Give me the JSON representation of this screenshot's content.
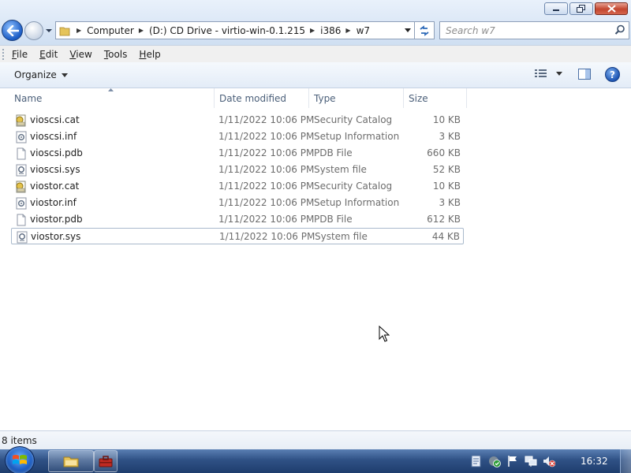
{
  "window": {
    "minimize_icon": "minimize-icon",
    "maximize_icon": "restore-icon",
    "close_icon": "close-icon"
  },
  "address": {
    "crumbs": [
      "Computer",
      "(D:) CD Drive - virtio-win-0.1.215",
      "i386",
      "w7"
    ]
  },
  "search": {
    "placeholder": "Search w7"
  },
  "menu": {
    "file": "File",
    "edit": "Edit",
    "view": "View",
    "tools": "Tools",
    "help": "Help"
  },
  "toolbar": {
    "organize_label": "Organize",
    "help_label": "?"
  },
  "columns": {
    "name": "Name",
    "date": "Date modified",
    "type": "Type",
    "size": "Size"
  },
  "files": [
    {
      "name": "vioscsi.cat",
      "date": "1/11/2022 10:06 PM",
      "type": "Security Catalog",
      "size": "10 KB",
      "icon": "catalog-icon"
    },
    {
      "name": "vioscsi.inf",
      "date": "1/11/2022 10:06 PM",
      "type": "Setup Information",
      "size": "3 KB",
      "icon": "setup-info-icon"
    },
    {
      "name": "vioscsi.pdb",
      "date": "1/11/2022 10:06 PM",
      "type": "PDB File",
      "size": "660 KB",
      "icon": "blank-file-icon"
    },
    {
      "name": "vioscsi.sys",
      "date": "1/11/2022 10:06 PM",
      "type": "System file",
      "size": "52 KB",
      "icon": "system-file-icon"
    },
    {
      "name": "viostor.cat",
      "date": "1/11/2022 10:06 PM",
      "type": "Security Catalog",
      "size": "10 KB",
      "icon": "catalog-icon"
    },
    {
      "name": "viostor.inf",
      "date": "1/11/2022 10:06 PM",
      "type": "Setup Information",
      "size": "3 KB",
      "icon": "setup-info-icon"
    },
    {
      "name": "viostor.pdb",
      "date": "1/11/2022 10:06 PM",
      "type": "PDB File",
      "size": "612 KB",
      "icon": "blank-file-icon"
    },
    {
      "name": "viostor.sys",
      "date": "1/11/2022 10:06 PM",
      "type": "System file",
      "size": "44 KB",
      "icon": "system-file-icon"
    }
  ],
  "status": {
    "item_count": "8 items"
  },
  "taskbar": {
    "clock": "16:32"
  },
  "colors": {
    "accent": "#1d55b3",
    "selection_border": "#a9b9cc",
    "taskbar": "#2f5185"
  }
}
